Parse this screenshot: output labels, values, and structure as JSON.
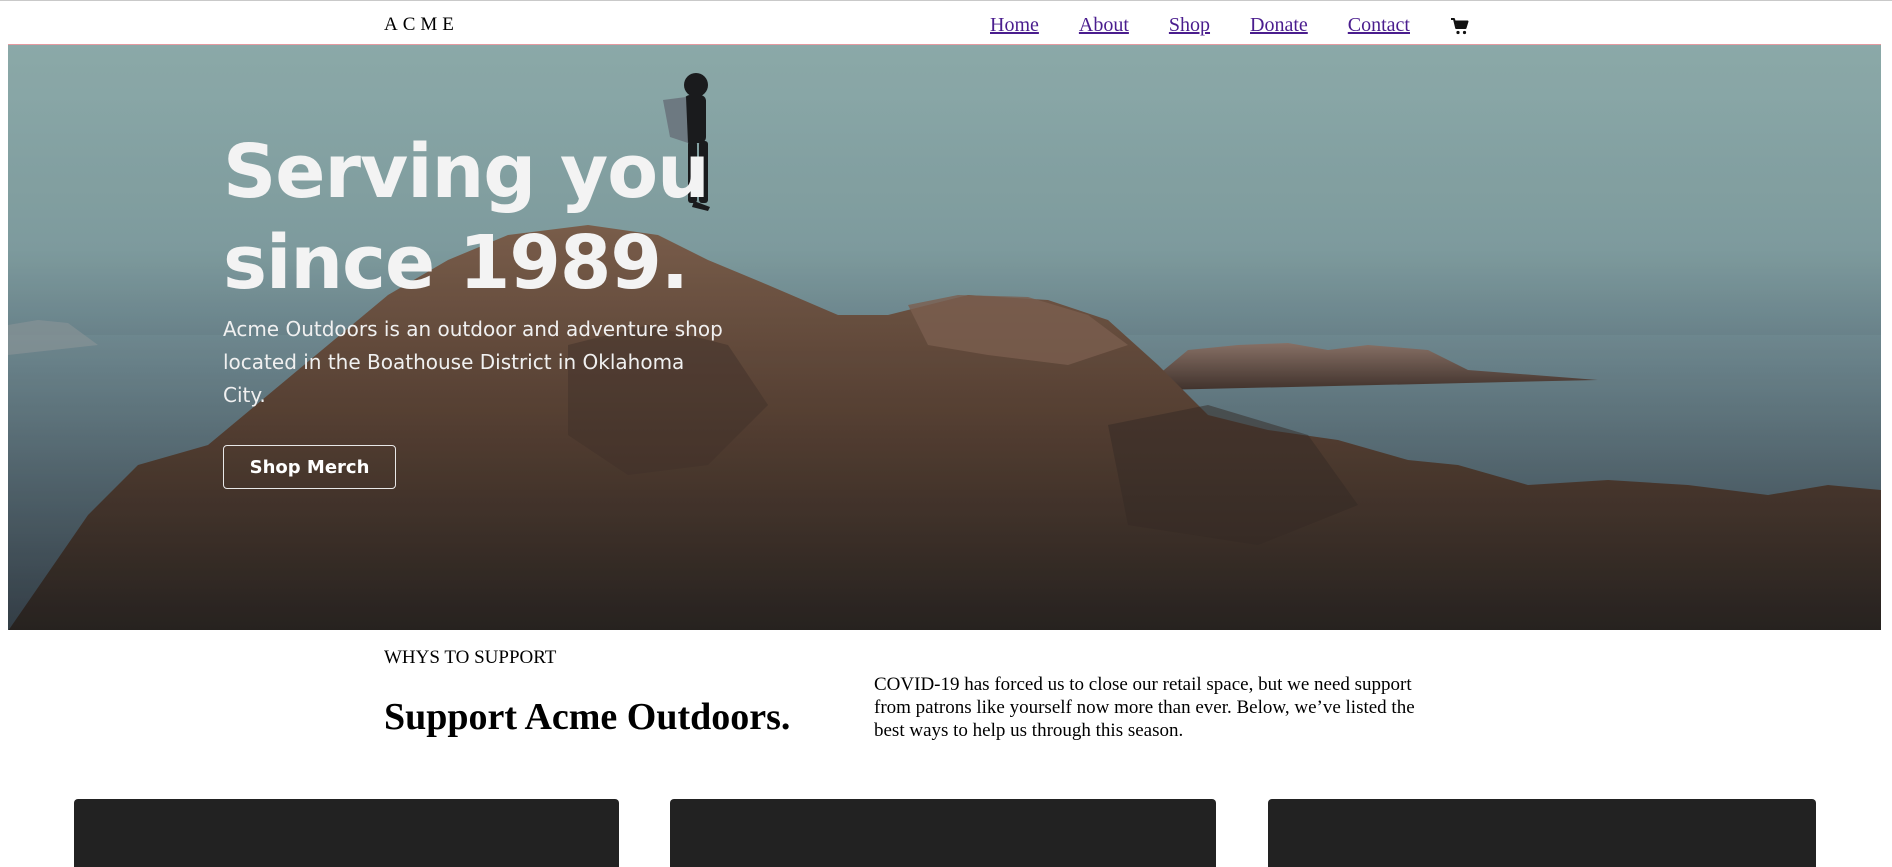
{
  "header": {
    "brand": "ACME",
    "nav": [
      {
        "label": "Home"
      },
      {
        "label": "About"
      },
      {
        "label": "Shop"
      },
      {
        "label": "Donate"
      },
      {
        "label": "Contact"
      }
    ],
    "cart_icon": "shopping-cart-icon"
  },
  "hero": {
    "title": "Serving you since 1989.",
    "description": "Acme Outdoors is an outdoor and adventure shop located in the Boathouse District in Oklahoma City.",
    "button_label": "Shop Merch",
    "image": "hiker-on-coastal-rocks"
  },
  "support": {
    "eyebrow": "WHYS TO SUPPORT",
    "title": "Support Acme Outdoors.",
    "text": "COVID-19 has forced us to close our retail space, but we need support from patrons like yourself now more than ever. Below, we’ve listed the best ways to help us through this season."
  },
  "colors": {
    "link": "#4a1d8e",
    "card": "#222222",
    "hero_text": "#f3f3f3"
  }
}
